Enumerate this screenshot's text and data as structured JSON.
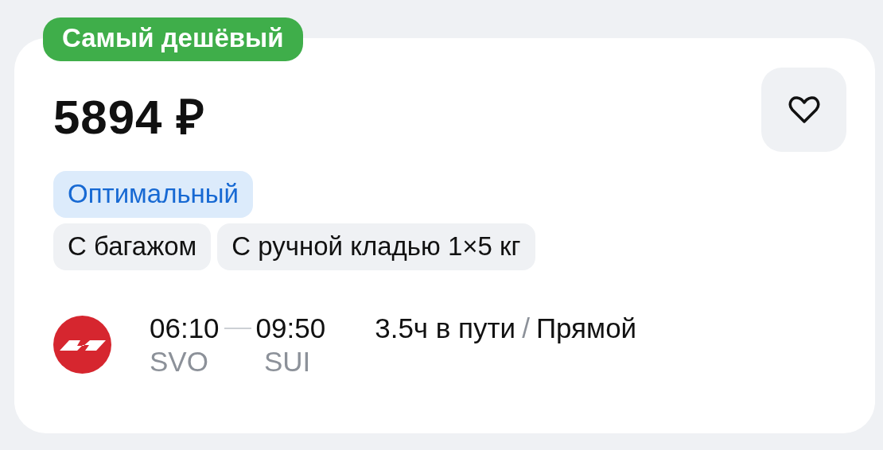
{
  "badge": "Самый дешёвый",
  "price": "5894 ₽",
  "favorite": false,
  "fare_tag": "Оптимальный",
  "features": [
    "С багажом",
    "С ручной кладью 1×5 кг"
  ],
  "flight": {
    "departure_time": "06:10",
    "arrival_time": "09:50",
    "departure_airport": "SVO",
    "arrival_airport": "SUI",
    "duration": "3.5ч в пути",
    "separator": "/",
    "type": "Прямой"
  }
}
